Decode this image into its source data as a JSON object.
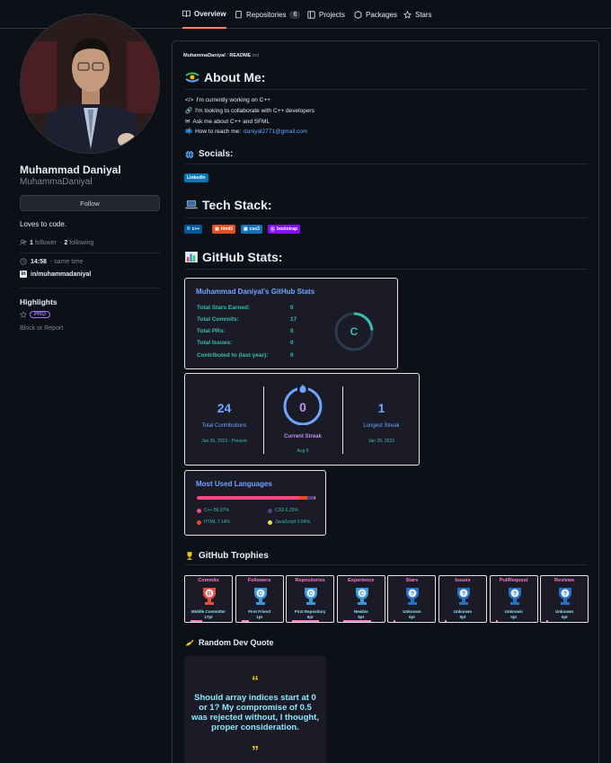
{
  "tabs": [
    {
      "label": "Overview"
    },
    {
      "label": "Repositories",
      "count": "6"
    },
    {
      "label": "Projects"
    },
    {
      "label": "Packages"
    },
    {
      "label": "Stars"
    }
  ],
  "profile": {
    "name": "Muhammad Daniyal",
    "login": "MuhammaDaniyal",
    "follow_label": "Follow",
    "bio": "Loves to code.",
    "followers_count": "1",
    "followers_label": "follower",
    "following_count": "2",
    "following_label": "following",
    "time": "14:58",
    "time_note": "- same time",
    "linkedin": "in/muhammadaniyal",
    "highlights_title": "Highlights",
    "pro_label": "PRO",
    "block_label": "Block or Report"
  },
  "readme": {
    "path_user": "MuhammaDaniyal",
    "path_sep": " / ",
    "path_file": "README",
    "path_ext": ".md",
    "about_title": "About Me:",
    "about_lines": [
      {
        "icon": "</>",
        "text": "I'm currently working on C++"
      },
      {
        "icon": "🔗",
        "text": "I'm looking to collaborate with C++ developers"
      },
      {
        "icon": "✉",
        "text": "Ask me about C++ and SFML"
      },
      {
        "icon": "📫",
        "text": "How to reach me:"
      }
    ],
    "email": "daniyal2771@gmail.com",
    "socials_title": "Socials:",
    "linkedin_badge": "LinkedIn",
    "tech_title": "Tech Stack:",
    "tech_badges": [
      {
        "label": "c++",
        "color": "#00599C"
      },
      {
        "label": "html5",
        "color": "#E34F26"
      },
      {
        "label": "css3",
        "color": "#1572B6"
      },
      {
        "label": "bootstrap",
        "color": "#8511FA"
      }
    ],
    "stats_title": "GitHub Stats:",
    "stats_card": {
      "title": "Muhammad Daniyal's GitHub Stats",
      "rows": [
        {
          "label": "Total Stars Earned:",
          "value": "0"
        },
        {
          "label": "Total Commits:",
          "value": "17"
        },
        {
          "label": "Total PRs:",
          "value": "0"
        },
        {
          "label": "Total Issues:",
          "value": "0"
        },
        {
          "label": "Contributed to (last year):",
          "value": "0"
        }
      ],
      "grade": "C"
    },
    "streak": {
      "total": "24",
      "total_label": "Total Contributions",
      "total_range": "Jan 26, 2023 - Present",
      "current": "0",
      "current_label": "Current Streak",
      "current_date": "Aug 6",
      "longest": "1",
      "longest_label": "Longest Streak",
      "longest_date": "Jan 26, 2023"
    },
    "languages": {
      "title": "Most Used Languages",
      "items": [
        {
          "label": "C++ 86.07%",
          "color": "#f34b7d",
          "value": 86.07
        },
        {
          "label": "CSS 6.25%",
          "color": "#563d7c",
          "value": 6.25
        },
        {
          "label": "HTML 7.14%",
          "color": "#e34c26",
          "value": 7.14
        },
        {
          "label": "JavaScript 0.54%",
          "color": "#f1e05a",
          "value": 0.54
        }
      ]
    },
    "trophies_title": "GitHub Trophies",
    "trophies": [
      {
        "title": "Commits",
        "rank": "Middle Committer",
        "pts": "17pt",
        "grade": "B",
        "color": "#e74c3c",
        "progress": 0.3
      },
      {
        "title": "Followers",
        "rank": "First Friend",
        "pts": "1pt",
        "grade": "C",
        "color": "#3498db",
        "progress": 0.2
      },
      {
        "title": "Repositories",
        "rank": "First Repository",
        "pts": "6pt",
        "grade": "C",
        "color": "#3498db",
        "progress": 0.7
      },
      {
        "title": "Experience",
        "rank": "Newbie",
        "pts": "5pt",
        "grade": "C",
        "color": "#3498db",
        "progress": 0.75
      },
      {
        "title": "Stars",
        "rank": "Unknown",
        "pts": "0pt",
        "grade": "?",
        "color": "#2472c8",
        "progress": 0.05
      },
      {
        "title": "Issues",
        "rank": "Unknown",
        "pts": "0pt",
        "grade": "?",
        "color": "#2472c8",
        "progress": 0.05
      },
      {
        "title": "PullRequest",
        "rank": "Unknown",
        "pts": "0pt",
        "grade": "?",
        "color": "#2472c8",
        "progress": 0.05
      },
      {
        "title": "Reviews",
        "rank": "Unknown",
        "pts": "0pt",
        "grade": "?",
        "color": "#2472c8",
        "progress": 0.05
      }
    ],
    "quote_title": "Random Dev Quote",
    "quote_open": "“",
    "quote_text": "Should array indices start at 0 or 1? My compromise of 0.5 was rejected without, I thought, proper consideration.",
    "quote_close": "”"
  }
}
